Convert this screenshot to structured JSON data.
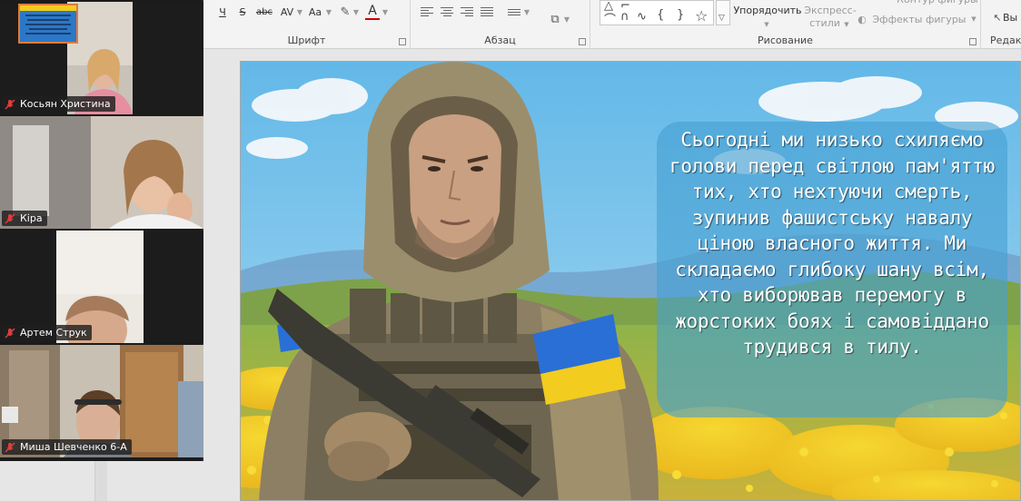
{
  "ribbon": {
    "font_group_label": "Шрифт",
    "paragraph_group_label": "Абзац",
    "drawing_group_label": "Рисование",
    "editing_group_label": "Редакт",
    "font_tools": {
      "strike": "S",
      "abc": "abc",
      "av": "AV",
      "aa": "Aa",
      "font_color": "A"
    },
    "arrange_label": "Упорядочить",
    "quick_styles_label": "Экспресс-",
    "quick_styles_label2": "стили",
    "shape_outline_label": "Контур фигуры",
    "shape_effects_label": "Эффекты фигуры",
    "select_label": "Вы"
  },
  "participants": [
    {
      "name": "Косьян Христина"
    },
    {
      "name": "Кіра"
    },
    {
      "name": "Артем Струк"
    },
    {
      "name": "Миша Шевченко 6-А"
    }
  ],
  "slide": {
    "text": "Сьогодні ми низько схиляємо голови перед світлою пам'яттю тих, хто нехтуючи смерть, зупинив фашистську навалу ціною власного життя. Ми складаємо глибоку шану всім, хто виборював перемогу в жорстоких боях і самовіддано трудився в тилу."
  },
  "colors": {
    "ribbon_bg": "#f3f3f3",
    "video_panel_bg": "#1b1b1b",
    "caption_box": "#46a0d2",
    "flag_blue": "#2a6fd6",
    "flag_yellow": "#f2cc1f",
    "thumbnail_border": "#e07b39"
  }
}
